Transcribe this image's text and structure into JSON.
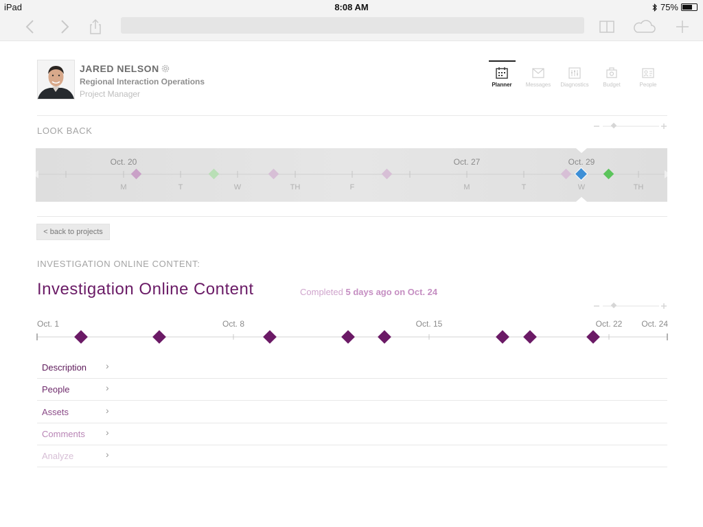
{
  "status_bar": {
    "device": "iPad",
    "time": "8:08 AM",
    "battery": "75%",
    "battery_level": 0.75
  },
  "browser": {
    "address": ""
  },
  "profile": {
    "name": "JARED NELSON",
    "organization": "Regional Interaction Operations",
    "role": "Project Manager"
  },
  "nav": {
    "items": [
      {
        "label": "Planner",
        "active": true
      },
      {
        "label": "Messages",
        "active": false
      },
      {
        "label": "Diagnostics",
        "active": false
      },
      {
        "label": "Budget",
        "active": false
      },
      {
        "label": "People",
        "active": false
      }
    ]
  },
  "look_back": {
    "title": "LOOK BACK",
    "dates": [
      "Oct. 20",
      "Oct. 27",
      "Oct. 29"
    ],
    "weekdays": [
      "M",
      "T",
      "W",
      "TH",
      "F",
      "M",
      "T",
      "W",
      "TH"
    ]
  },
  "back_button": "< back to projects",
  "project": {
    "section_label": "INVESTIGATION ONLINE CONTENT:",
    "title": "Investigation Online Content",
    "completed_prefix": "Completed ",
    "completed_ago": "5 days ago on Oct. 24"
  },
  "timeline": {
    "dates": [
      "Oct. 1",
      "Oct. 8",
      "Oct. 15",
      "Oct. 22",
      "Oct. 24"
    ]
  },
  "details": [
    {
      "label": "Description",
      "color": "#5d1a5a"
    },
    {
      "label": "People",
      "color": "#6e2a6b"
    },
    {
      "label": "Assets",
      "color": "#8a4a87"
    },
    {
      "label": "Comments",
      "color": "#b884b5"
    },
    {
      "label": "Analyze",
      "color": "#d7bfd6"
    }
  ],
  "colors": {
    "purple": "#6b1a66",
    "light_purple": "#cda7cb",
    "green": "#5bc45b",
    "blue": "#3e8fd6"
  }
}
